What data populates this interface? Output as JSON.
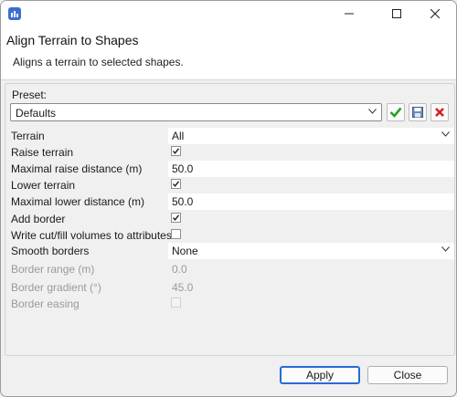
{
  "window": {
    "title": "Align Terrain to Shapes",
    "description": "Aligns a terrain to selected shapes."
  },
  "preset": {
    "label": "Preset:",
    "value": "Defaults"
  },
  "properties": [
    {
      "label": "Terrain",
      "type": "dropdown",
      "value": "All"
    },
    {
      "label": "Raise terrain",
      "type": "checkbox",
      "checked": true
    },
    {
      "label": "Maximal raise distance (m)",
      "type": "number",
      "value": "50.0"
    },
    {
      "label": "Lower terrain",
      "type": "checkbox",
      "checked": true
    },
    {
      "label": "Maximal lower distance (m)",
      "type": "number",
      "value": "50.0"
    },
    {
      "label": "Add border",
      "type": "checkbox",
      "checked": true
    },
    {
      "label": "Write cut/fill volumes to attributes",
      "type": "checkbox",
      "checked": false
    },
    {
      "label": "Smooth borders",
      "type": "dropdown",
      "value": "None"
    },
    {
      "label": "Border range (m)",
      "type": "number",
      "value": "0.0",
      "disabled": true
    },
    {
      "label": "Border gradient (°)",
      "type": "number",
      "value": "45.0",
      "disabled": true
    },
    {
      "label": "Border easing",
      "type": "checkbox",
      "checked": false,
      "disabled": true
    }
  ],
  "buttons": {
    "apply": "Apply",
    "close": "Close"
  },
  "icons": {
    "app": "app-icon",
    "minimize": "minimize-icon",
    "maximize": "maximize-icon",
    "close": "close-icon",
    "preset_apply": "checkmark-icon",
    "preset_save": "save-icon",
    "preset_delete": "delete-icon"
  },
  "colors": {
    "accent": "#2a6ad6",
    "apply_icon": "#2aa02a",
    "delete_icon": "#d52020"
  }
}
